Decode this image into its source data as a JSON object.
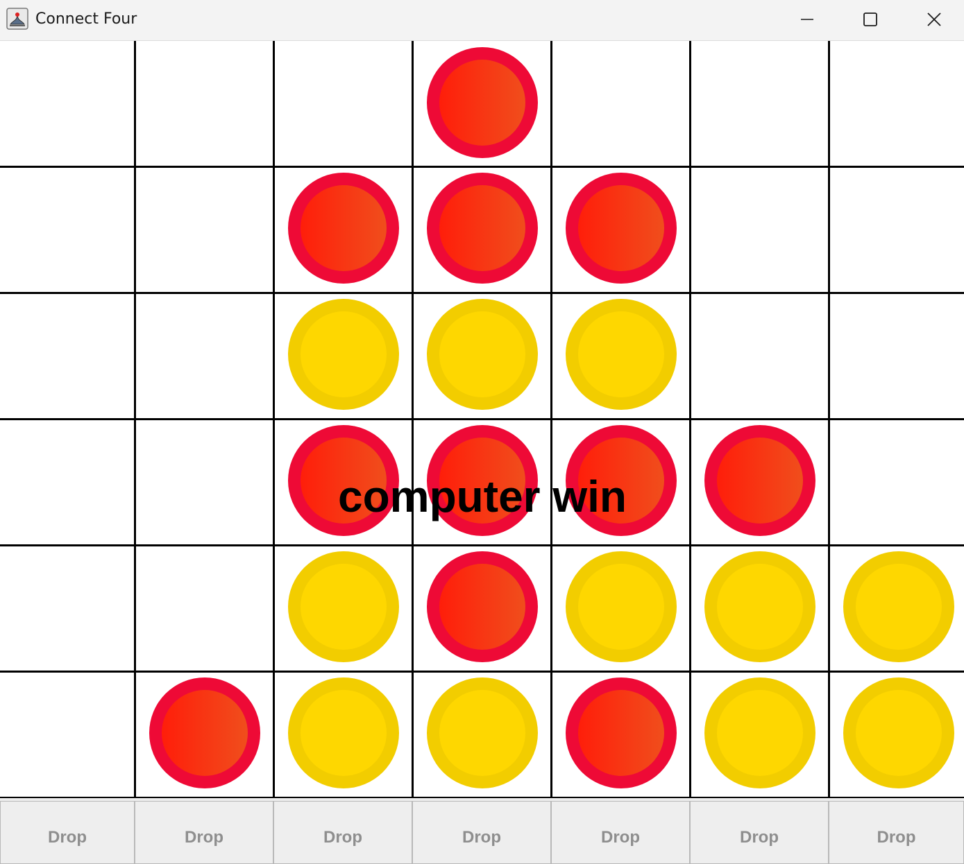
{
  "window": {
    "title": "Connect Four"
  },
  "status": {
    "message": "computer win"
  },
  "colors": {
    "red_outer": "#ee0a36",
    "red_inner_start": "#ff1e0a",
    "red_inner_end": "#f04e1c",
    "yellow_outer": "#f2cd00",
    "yellow_inner": "#fed700",
    "grid_line": "#000000"
  },
  "board": {
    "rows": 6,
    "columns": 7,
    "cells": [
      [
        "",
        "",
        "",
        "R",
        "",
        "",
        ""
      ],
      [
        "",
        "",
        "R",
        "R",
        "R",
        "",
        ""
      ],
      [
        "",
        "",
        "Y",
        "Y",
        "Y",
        "",
        ""
      ],
      [
        "",
        "",
        "R",
        "R",
        "R",
        "R",
        ""
      ],
      [
        "",
        "",
        "Y",
        "R",
        "Y",
        "Y",
        "Y"
      ],
      [
        "",
        "R",
        "Y",
        "Y",
        "R",
        "Y",
        "Y"
      ]
    ]
  },
  "buttons": [
    {
      "label": "Drop"
    },
    {
      "label": "Drop"
    },
    {
      "label": "Drop"
    },
    {
      "label": "Drop"
    },
    {
      "label": "Drop"
    },
    {
      "label": "Drop"
    },
    {
      "label": "Drop"
    }
  ]
}
